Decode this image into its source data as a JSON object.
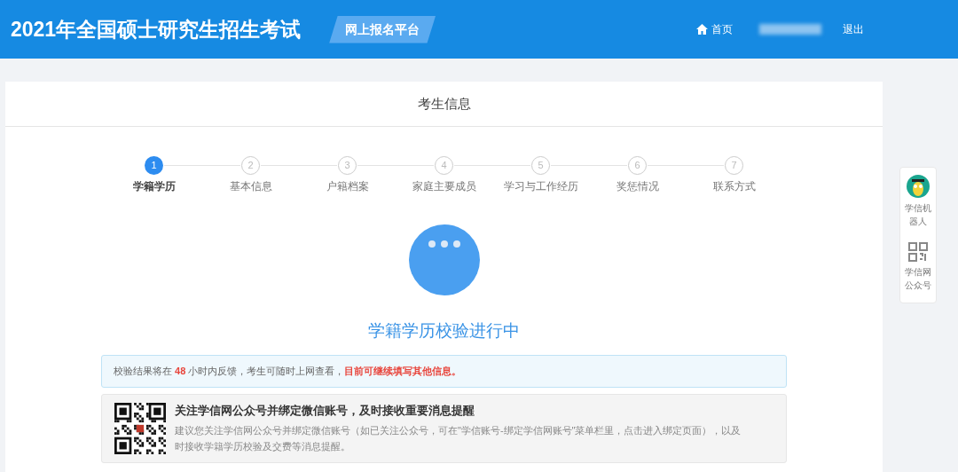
{
  "header": {
    "title": "2021年全国硕士研究生招生考试",
    "platform_badge": "网上报名平台",
    "home_link": "首页",
    "logout_link": "退出"
  },
  "card_title": "考生信息",
  "steps": [
    {
      "number": "1",
      "label": "学籍学历",
      "selected": true
    },
    {
      "number": "2",
      "label": "基本信息",
      "selected": false
    },
    {
      "number": "3",
      "label": "户籍档案",
      "selected": false
    },
    {
      "number": "4",
      "label": "家庭主要成员",
      "selected": false
    },
    {
      "number": "5",
      "label": "学习与工作经历",
      "selected": false
    },
    {
      "number": "6",
      "label": "奖惩情况",
      "selected": false
    },
    {
      "number": "7",
      "label": "联系方式",
      "selected": false
    }
  ],
  "status_title": "学籍学历校验进行中",
  "notice": [
    {
      "text": "校验结果将在 ",
      "highlight": false
    },
    {
      "text": "48",
      "highlight": true
    },
    {
      "text": " 小时内反馈，考生可随时上网查看，",
      "highlight": false
    },
    {
      "text": "目前可继续填写其他信息。",
      "highlight": true
    }
  ],
  "wechat": {
    "title": "关注学信网公众号并绑定微信账号，及时接收重要消息提醒",
    "description": "建议您关注学信网公众号并绑定微信账号（如已关注公众号，可在\"学信账号-绑定学信网账号\"菜单栏里，点击进入绑定页面），以及时接收学籍学历校验及交费等消息提醒。"
  },
  "side_tools": [
    {
      "kind": "robot",
      "label": "学信机器人"
    },
    {
      "kind": "qrcode",
      "label": "学信网公众号"
    }
  ]
}
